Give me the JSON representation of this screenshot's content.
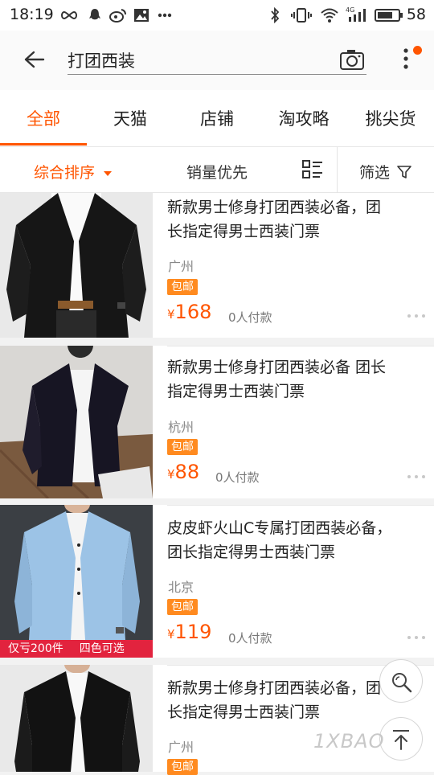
{
  "status_bar": {
    "time": "18:19",
    "battery": "58",
    "network": "4G"
  },
  "search": {
    "query": "打团西装"
  },
  "tabs": [
    {
      "label": "全部",
      "active": true
    },
    {
      "label": "天猫"
    },
    {
      "label": "店铺"
    },
    {
      "label": "淘攻略"
    },
    {
      "label": "挑尖货"
    }
  ],
  "sort": {
    "comprehensive": "综合排序",
    "sales_first": "销量优先",
    "filter": "筛选"
  },
  "products": [
    {
      "title_line1": "新款男士修身打团西装必备，团",
      "title_line2": "长指定得男士西装门票",
      "city": "广州",
      "badge": "包邮",
      "currency": "¥",
      "price": "168",
      "sales": "0人付款",
      "jacket_color": "#121212"
    },
    {
      "title_line1": "新款男士修身打团西装必备  团长",
      "title_line2": "指定得男士西装门票",
      "city": "杭州",
      "badge": "包邮",
      "currency": "¥",
      "price": "88",
      "sales": "0人付款",
      "jacket_color": "#171523"
    },
    {
      "title_line1": "皮皮虾火山C专属打团西装必备，",
      "title_line2": "团长指定得男士西装门票",
      "city": "北京",
      "badge": "包邮",
      "currency": "¥",
      "price": "119",
      "sales": "0人付款",
      "jacket_color": "#9cc3e6",
      "promo_left": "仅亏200件",
      "promo_right": "四色可选"
    },
    {
      "title_line1": "新款男士修身打团西装必备，团",
      "title_line2": "长指定得男士西装门票",
      "city": "广州",
      "badge": "包邮",
      "jacket_color": "#121212"
    }
  ],
  "watermark": "1XBAO",
  "colors": {
    "accent": "#ff5500",
    "badge": "#ff8a1f",
    "promo": "#e2233e"
  }
}
